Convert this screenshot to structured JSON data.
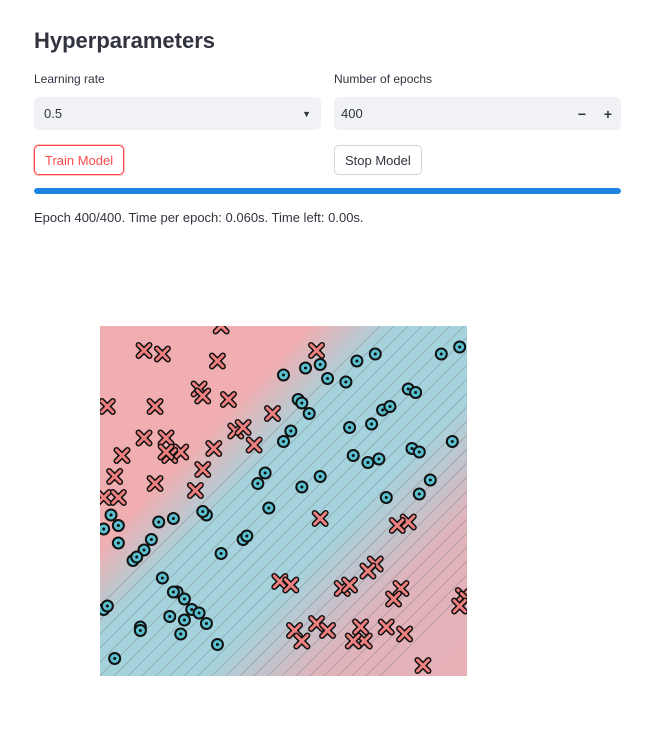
{
  "header": {
    "title": "Hyperparameters"
  },
  "learning_rate": {
    "label": "Learning rate",
    "value": "0.5"
  },
  "epochs": {
    "label": "Number of epochs",
    "value": "400",
    "minus": "−",
    "plus": "+"
  },
  "buttons": {
    "train": "Train Model",
    "stop": "Stop Model"
  },
  "progress": {
    "fraction": 1.0
  },
  "status": {
    "text": "Epoch 400/400. Time per epoch: 0.060s. Time left: 0.00s."
  },
  "colors": {
    "class_x": "#f08080",
    "class_o": "#5bc0d0",
    "region_x": "#f0aeb0",
    "region_o": "#a5d3dd",
    "accent": "#ff4b4b",
    "progress": "#1c83e1"
  },
  "chart_data": {
    "type": "scatter",
    "xlim": [
      0,
      1
    ],
    "ylim": [
      0,
      1
    ],
    "grid": false,
    "decision_boundary": "diagonal band of class O from bottom-left to top-right with class X on both sides",
    "series": [
      {
        "marker": "x",
        "x": [
          0.33,
          0.12,
          0.17,
          0.59,
          0.32,
          0.27,
          0.28,
          0.35,
          0.15,
          0.18,
          0.06,
          0.04,
          0.31,
          0.22,
          0.12,
          0.19,
          0.42,
          0.37,
          0.39,
          0.47,
          0.15,
          0.26,
          0.28,
          0.01,
          0.05,
          0.02,
          0.18,
          0.6,
          0.84,
          0.81,
          0.75,
          0.73,
          0.49,
          0.66,
          0.52,
          0.68,
          0.82,
          0.59,
          0.53,
          0.71,
          0.78,
          0.83,
          0.99,
          1.0,
          0.98,
          0.72,
          0.69,
          0.55,
          0.62,
          0.8,
          0.88
        ],
        "y": [
          1.0,
          0.93,
          0.92,
          0.93,
          0.9,
          0.82,
          0.8,
          0.79,
          0.77,
          0.68,
          0.63,
          0.57,
          0.65,
          0.64,
          0.68,
          0.63,
          0.66,
          0.7,
          0.71,
          0.75,
          0.55,
          0.53,
          0.59,
          0.51,
          0.51,
          0.77,
          0.64,
          0.45,
          0.44,
          0.43,
          0.32,
          0.3,
          0.27,
          0.25,
          0.26,
          0.26,
          0.25,
          0.15,
          0.13,
          0.14,
          0.14,
          0.12,
          0.23,
          0.22,
          0.2,
          0.1,
          0.1,
          0.1,
          0.13,
          0.22,
          0.03
        ]
      },
      {
        "marker": "o",
        "x": [
          0.5,
          0.56,
          0.6,
          0.62,
          0.67,
          0.7,
          0.75,
          0.93,
          0.98,
          0.84,
          0.86,
          0.54,
          0.57,
          0.55,
          0.52,
          0.5,
          0.68,
          0.74,
          0.77,
          0.79,
          0.85,
          0.87,
          0.96,
          0.69,
          0.6,
          0.55,
          0.76,
          0.73,
          0.78,
          0.87,
          0.9,
          0.43,
          0.45,
          0.29,
          0.28,
          0.33,
          0.39,
          0.4,
          0.46,
          0.2,
          0.16,
          0.12,
          0.14,
          0.05,
          0.05,
          0.01,
          0.03,
          0.09,
          0.1,
          0.17,
          0.21,
          0.25,
          0.19,
          0.27,
          0.23,
          0.2,
          0.11,
          0.04,
          0.01,
          0.02,
          0.11,
          0.22,
          0.23,
          0.29,
          0.32
        ],
        "y": [
          0.86,
          0.88,
          0.89,
          0.85,
          0.84,
          0.9,
          0.92,
          0.92,
          0.94,
          0.82,
          0.81,
          0.79,
          0.75,
          0.78,
          0.7,
          0.67,
          0.71,
          0.72,
          0.76,
          0.77,
          0.65,
          0.64,
          0.67,
          0.63,
          0.57,
          0.54,
          0.62,
          0.61,
          0.51,
          0.52,
          0.56,
          0.55,
          0.58,
          0.46,
          0.47,
          0.35,
          0.39,
          0.4,
          0.48,
          0.45,
          0.44,
          0.36,
          0.39,
          0.43,
          0.38,
          0.42,
          0.46,
          0.33,
          0.34,
          0.28,
          0.24,
          0.19,
          0.17,
          0.18,
          0.22,
          0.24,
          0.14,
          0.05,
          0.19,
          0.2,
          0.13,
          0.12,
          0.16,
          0.15,
          0.09
        ]
      }
    ]
  }
}
